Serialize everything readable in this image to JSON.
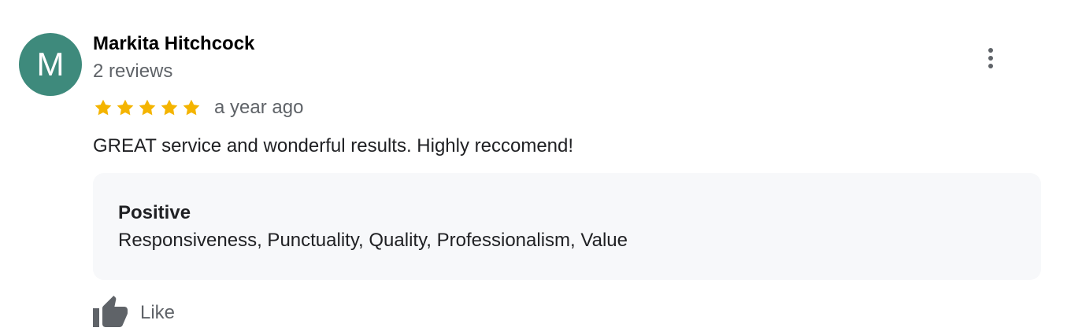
{
  "review": {
    "avatar_letter": "M",
    "avatar_color": "#3e8a7c",
    "author_name": "Markita Hitchcock",
    "review_count": "2 reviews",
    "rating": 5,
    "rating_max": 5,
    "star_color": "#f4b400",
    "date": "a year ago",
    "text": "GREAT service and wonderful results. Highly reccomend!",
    "attributes": {
      "title": "Positive",
      "values": "Responsiveness, Punctuality, Quality, Professionalism, Value"
    },
    "actions": {
      "like_label": "Like",
      "like_icon": "thumbs-up-icon",
      "more_icon": "more-vertical-icon"
    }
  }
}
